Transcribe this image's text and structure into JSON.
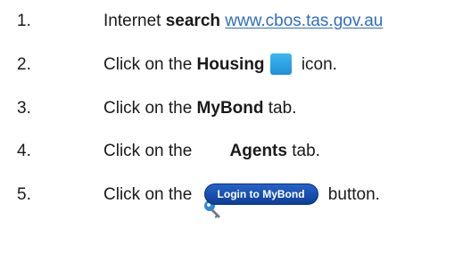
{
  "steps": [
    {
      "number": "1.",
      "parts": {
        "a": "Internet ",
        "b": "search",
        "c": " ",
        "link": "www.cbos.tas.gov.au"
      }
    },
    {
      "number": "2.",
      "parts": {
        "a": "Click on the ",
        "b": "Housing",
        "c": " icon."
      },
      "icon": "home-icon"
    },
    {
      "number": "3.",
      "parts": {
        "a": "Click on the ",
        "b": "MyBond",
        "c": " tab."
      }
    },
    {
      "number": "4.",
      "parts": {
        "a": "Click on the ",
        "b": "Agents",
        "c": " tab."
      },
      "icon": "key-icon"
    },
    {
      "number": "5.",
      "parts": {
        "a": "Click on the ",
        "button": "Login to MyBond",
        "c": " button."
      }
    }
  ],
  "colors": {
    "link": "#2f6fc0",
    "housing_icon": "#2aa3e6",
    "key_icon": "#2f86d8",
    "login_button": "#1a4fb0"
  }
}
